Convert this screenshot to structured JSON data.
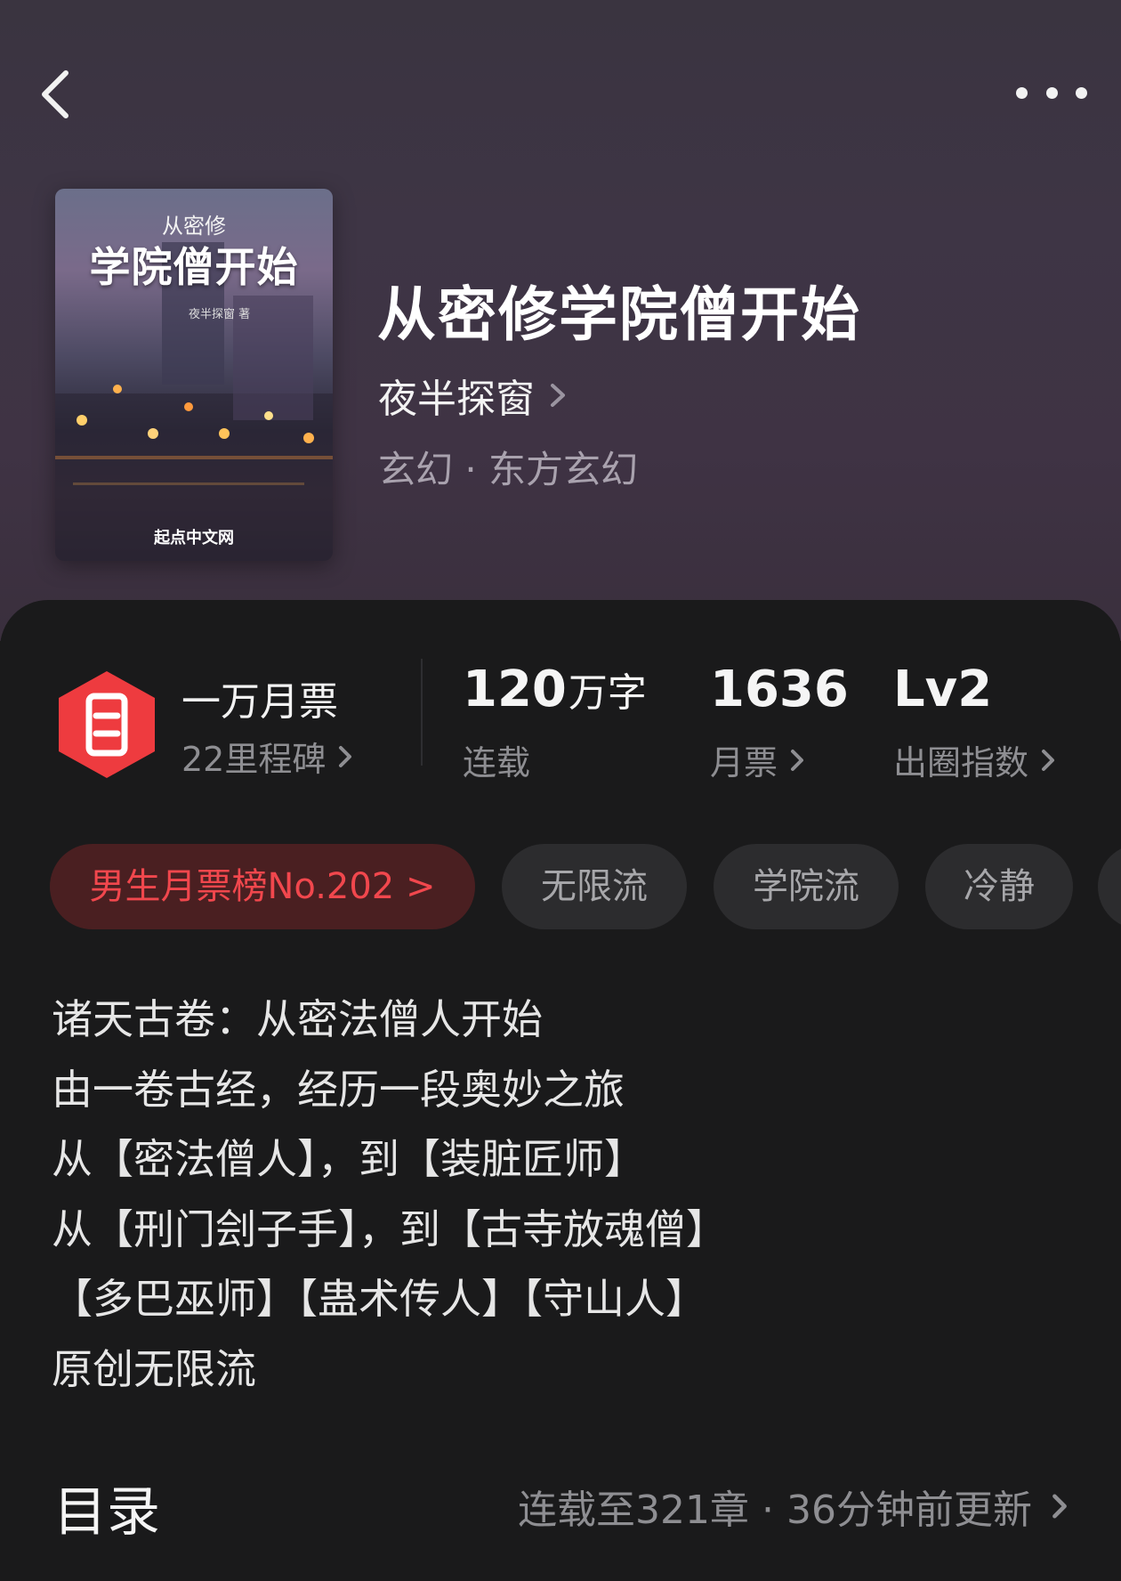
{
  "book": {
    "title": "从密修学院僧开始",
    "author": "夜半探窗",
    "genre": "玄幻 · 东方玄幻"
  },
  "cover": {
    "subtitle": "从密修",
    "title": "学院僧开始",
    "author_line": "夜半探窗 著",
    "publisher": "起点中文网"
  },
  "stats": {
    "ticket": {
      "title": "一万月票",
      "sub": "22里程碑"
    },
    "words": {
      "number": "120",
      "unit": "万字",
      "label": "连载"
    },
    "monthly": {
      "number": "1636",
      "label": "月票"
    },
    "level": {
      "number": "Lv2",
      "label": "出圈指数"
    }
  },
  "tags": [
    "男生月票榜No.202 >",
    "无限流",
    "学院流",
    "冷静"
  ],
  "intro": [
    "诸天古卷：从密法僧人开始",
    "由一卷古经，经历一段奥妙之旅",
    "从【密法僧人】，到【装脏匠师】",
    "从【刑门刽子手】，到【古寺放魂僧】",
    "【多巴巫师】【蛊术传人】【守山人】",
    "原创无限流"
  ],
  "toc": {
    "title": "目录",
    "meta": "连载至321章 · 36分钟前更新"
  },
  "colors": {
    "rank_tag_bg": "#4a1f21",
    "rank_tag_text": "#f1474d",
    "ticket_icon": "#ee3b3f"
  }
}
